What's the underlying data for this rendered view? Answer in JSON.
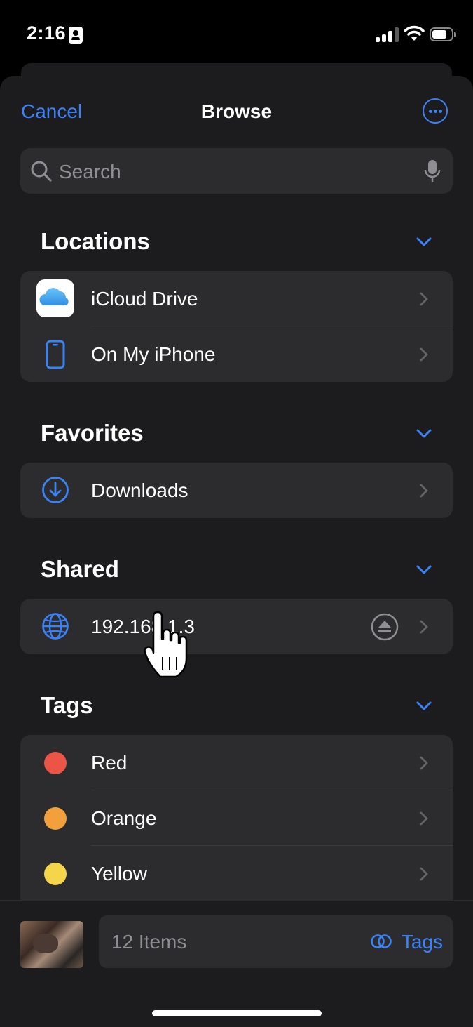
{
  "status_bar": {
    "time": "2:16"
  },
  "nav": {
    "cancel_label": "Cancel",
    "title": "Browse"
  },
  "search": {
    "placeholder": "Search"
  },
  "sections": {
    "locations": {
      "title": "Locations",
      "items": [
        {
          "label": "iCloud Drive",
          "icon": "icloud-icon"
        },
        {
          "label": "On My iPhone",
          "icon": "iphone-icon"
        }
      ]
    },
    "favorites": {
      "title": "Favorites",
      "items": [
        {
          "label": "Downloads",
          "icon": "download-icon"
        }
      ]
    },
    "shared": {
      "title": "Shared",
      "items": [
        {
          "label": "192.168.1.3",
          "icon": "globe-icon"
        }
      ]
    },
    "tags": {
      "title": "Tags",
      "items": [
        {
          "label": "Red",
          "color": "#eb5545"
        },
        {
          "label": "Orange",
          "color": "#f2a03c"
        },
        {
          "label": "Yellow",
          "color": "#f5d64a"
        }
      ]
    }
  },
  "bottom": {
    "items_count": "12 Items",
    "tags_label": "Tags"
  },
  "colors": {
    "accent": "#3b82f6",
    "background": "#1c1c1e",
    "cell": "#2c2c2e"
  }
}
